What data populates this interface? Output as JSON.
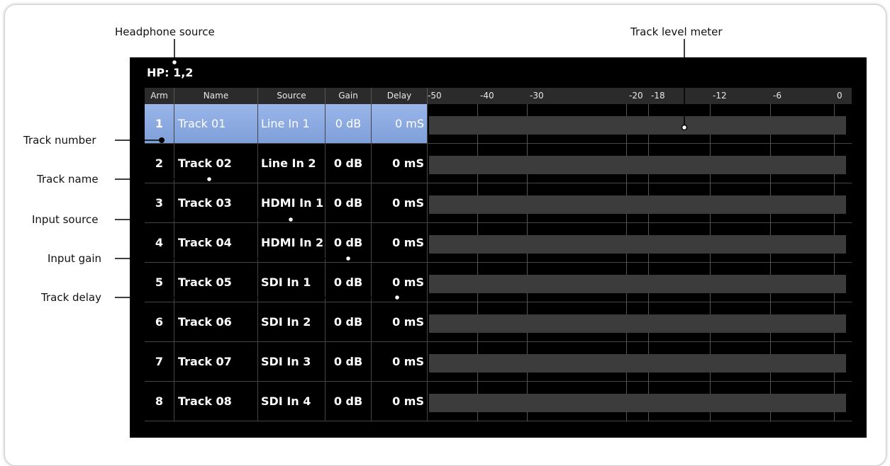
{
  "callouts": {
    "headphone_source": "Headphone source",
    "track_level_meter": "Track level meter",
    "track_number": "Track number",
    "track_name": "Track name",
    "input_source": "Input source",
    "input_gain": "Input gain",
    "track_delay": "Track delay"
  },
  "hp_label": "HP: 1,2",
  "headers": {
    "arm": "Arm",
    "name": "Name",
    "source": "Source",
    "gain": "Gain",
    "delay": "Delay"
  },
  "meter_scale": [
    "-50",
    "-40",
    "-30",
    "-20",
    "-18",
    "-12",
    "-6",
    "0"
  ],
  "tracks": [
    {
      "num": "1",
      "name": "Track 01",
      "source": "Line In 1",
      "gain": "0 dB",
      "delay": "0 mS"
    },
    {
      "num": "2",
      "name": "Track 02",
      "source": "Line In 2",
      "gain": "0 dB",
      "delay": "0 mS"
    },
    {
      "num": "3",
      "name": "Track 03",
      "source": "HDMI In 1",
      "gain": "0 dB",
      "delay": "0 mS"
    },
    {
      "num": "4",
      "name": "Track 04",
      "source": "HDMI In 2",
      "gain": "0 dB",
      "delay": "0 mS"
    },
    {
      "num": "5",
      "name": "Track 05",
      "source": "SDI In 1",
      "gain": "0 dB",
      "delay": "0 mS"
    },
    {
      "num": "6",
      "name": "Track 06",
      "source": "SDI In 2",
      "gain": "0 dB",
      "delay": "0 mS"
    },
    {
      "num": "7",
      "name": "Track 07",
      "source": "SDI In 3",
      "gain": "0 dB",
      "delay": "0 mS"
    },
    {
      "num": "8",
      "name": "Track 08",
      "source": "SDI In 4",
      "gain": "0 dB",
      "delay": "0 mS"
    }
  ],
  "colors": {
    "selected_row": "#8fadE4",
    "screen": "#000000",
    "meter_bar": "#3c3c3c"
  }
}
